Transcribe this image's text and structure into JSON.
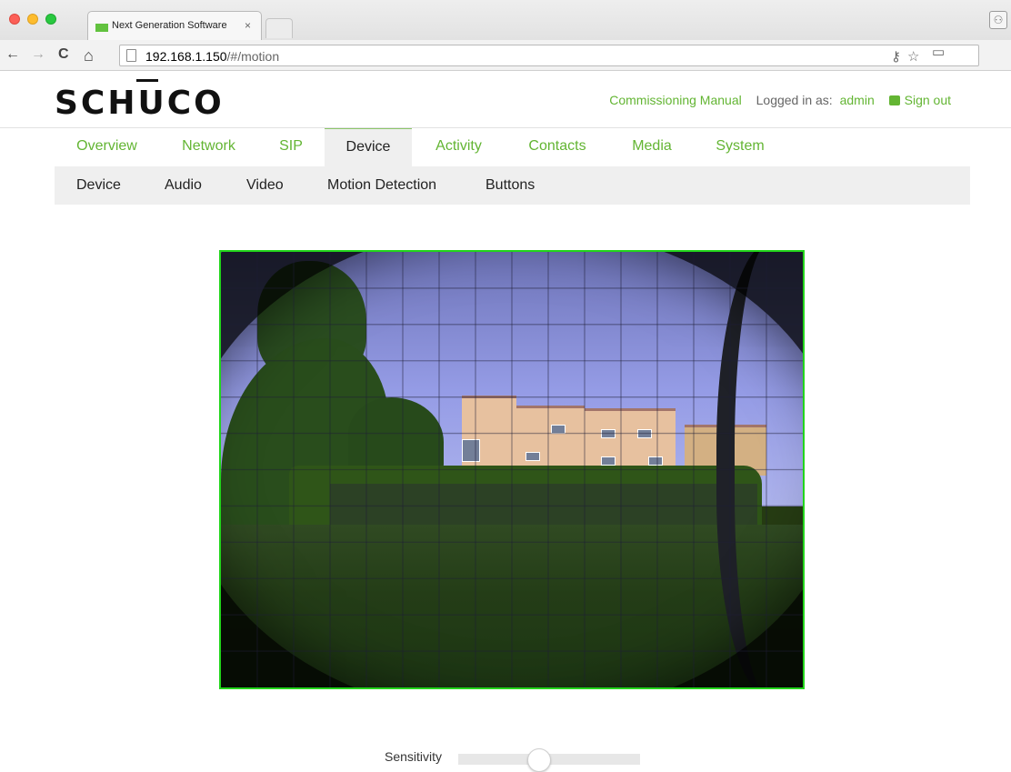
{
  "browser": {
    "tab_title": "Next Generation Software",
    "tab_close": "×",
    "back": "←",
    "forward": "→",
    "reload": "C",
    "home": "⌂",
    "url_host": "192.168.1.150",
    "url_path": "/#/motion",
    "key_icon": "⚷",
    "star_icon": "☆",
    "cast_icon": "▭",
    "menu_icon": "≡",
    "profile_icon": "⚇"
  },
  "header": {
    "logo": "SCHUCO",
    "commissioning_manual": "Commissioning Manual",
    "logged_in_label": "Logged in as:",
    "user": "admin",
    "sign_out": "Sign out"
  },
  "main_tabs": [
    {
      "label": "Overview"
    },
    {
      "label": "Network"
    },
    {
      "label": "SIP"
    },
    {
      "label": "Device"
    },
    {
      "label": "Activity"
    },
    {
      "label": "Contacts"
    },
    {
      "label": "Media"
    },
    {
      "label": "System"
    }
  ],
  "sub_tabs": [
    {
      "label": "Device"
    },
    {
      "label": "Audio"
    },
    {
      "label": "Video"
    },
    {
      "label": "Motion Detection"
    },
    {
      "label": "Buttons"
    }
  ],
  "motion": {
    "sensitivity_label": "Sensitivity",
    "sensitivity_value": 0.45,
    "grid_cols": 16,
    "grid_rows": 12
  },
  "colors": {
    "accent": "#63b533",
    "grid_border": "#22d51b"
  }
}
